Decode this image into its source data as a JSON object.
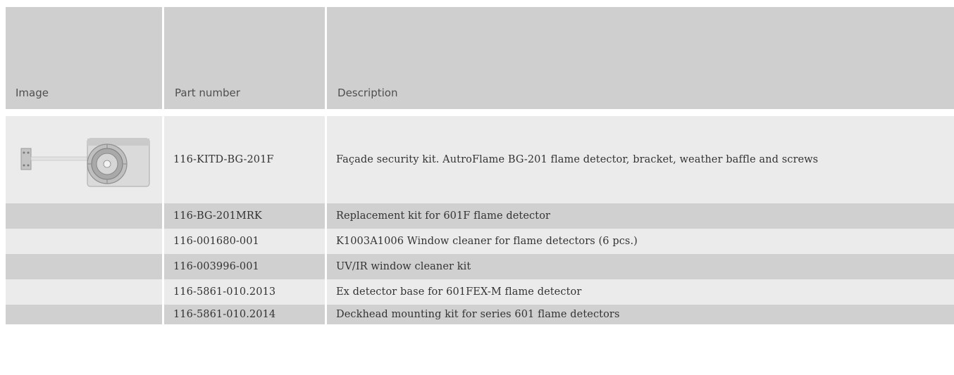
{
  "table": {
    "headers": {
      "image": "Image",
      "part_number": "Part number",
      "description": "Description"
    },
    "rows": [
      {
        "image_icon": "facade-security-kit-image",
        "part_number": "116-KITD-BG-201F",
        "description": "Façade security kit. AutroFlame BG-201 flame detector, bracket, weather baffle and screws"
      },
      {
        "part_number": "116-BG-201MRK",
        "description": "Replacement kit for 601F flame detector"
      },
      {
        "part_number": "116-001680-001",
        "description": "K1003A1006 Window cleaner for flame detectors (6 pcs.)"
      },
      {
        "part_number": "116-003996-001",
        "description": "UV/IR window cleaner kit"
      },
      {
        "part_number": "116-5861-010.2013",
        "description": "Ex detector base for 601FEX-M flame detector"
      },
      {
        "part_number": "116-5861-010.2014",
        "description": "Deckhead mounting kit for series 601 flame detectors"
      }
    ]
  },
  "colors": {
    "header_bg": "#cfcfcf",
    "row_light": "#ebebeb",
    "row_dark": "#d0d0d0"
  }
}
